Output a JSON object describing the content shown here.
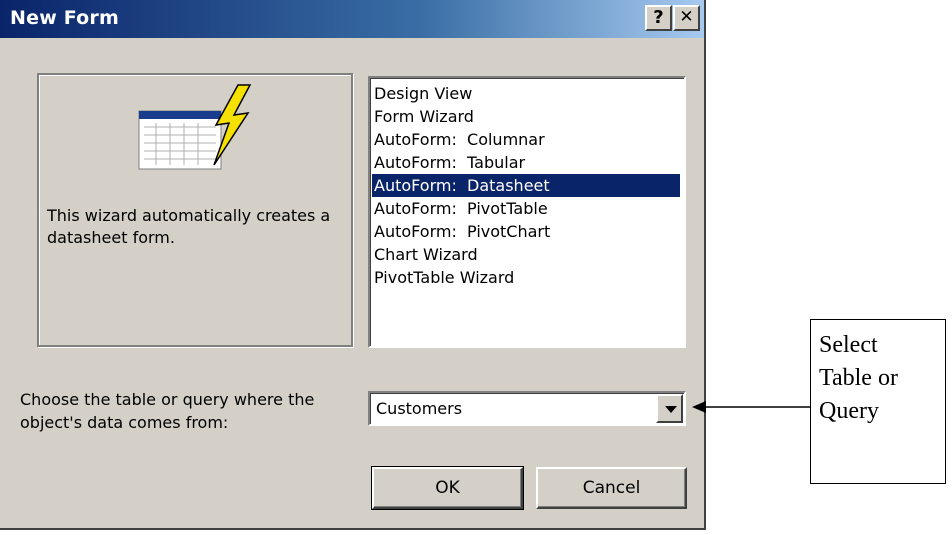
{
  "window": {
    "title": "New Form",
    "help_label": "?",
    "close_label": "✕"
  },
  "preview": {
    "icon": "datasheet-wizard-icon",
    "description": "This wizard automatically creates a datasheet form."
  },
  "view_list": {
    "items": [
      {
        "label": "Design View",
        "selected": false
      },
      {
        "label": "Form Wizard",
        "selected": false
      },
      {
        "label": "AutoForm:  Columnar",
        "selected": false
      },
      {
        "label": "AutoForm:  Tabular",
        "selected": false
      },
      {
        "label": "AutoForm:  Datasheet",
        "selected": true
      },
      {
        "label": "AutoForm:  PivotTable",
        "selected": false
      },
      {
        "label": "AutoForm:  PivotChart",
        "selected": false
      },
      {
        "label": "Chart Wizard",
        "selected": false
      },
      {
        "label": "PivotTable Wizard",
        "selected": false
      }
    ]
  },
  "source": {
    "label": "Choose the table or query where the object's data comes from:",
    "value": "Customers"
  },
  "buttons": {
    "ok": "OK",
    "cancel": "Cancel"
  },
  "callout": {
    "line1": "Select",
    "line2": "Table or",
    "line3": "Query"
  },
  "colors": {
    "title_start": "#0a246a",
    "title_end": "#a6caf0",
    "dialog_face": "#d4d0c8",
    "selection": "#0a246a"
  }
}
